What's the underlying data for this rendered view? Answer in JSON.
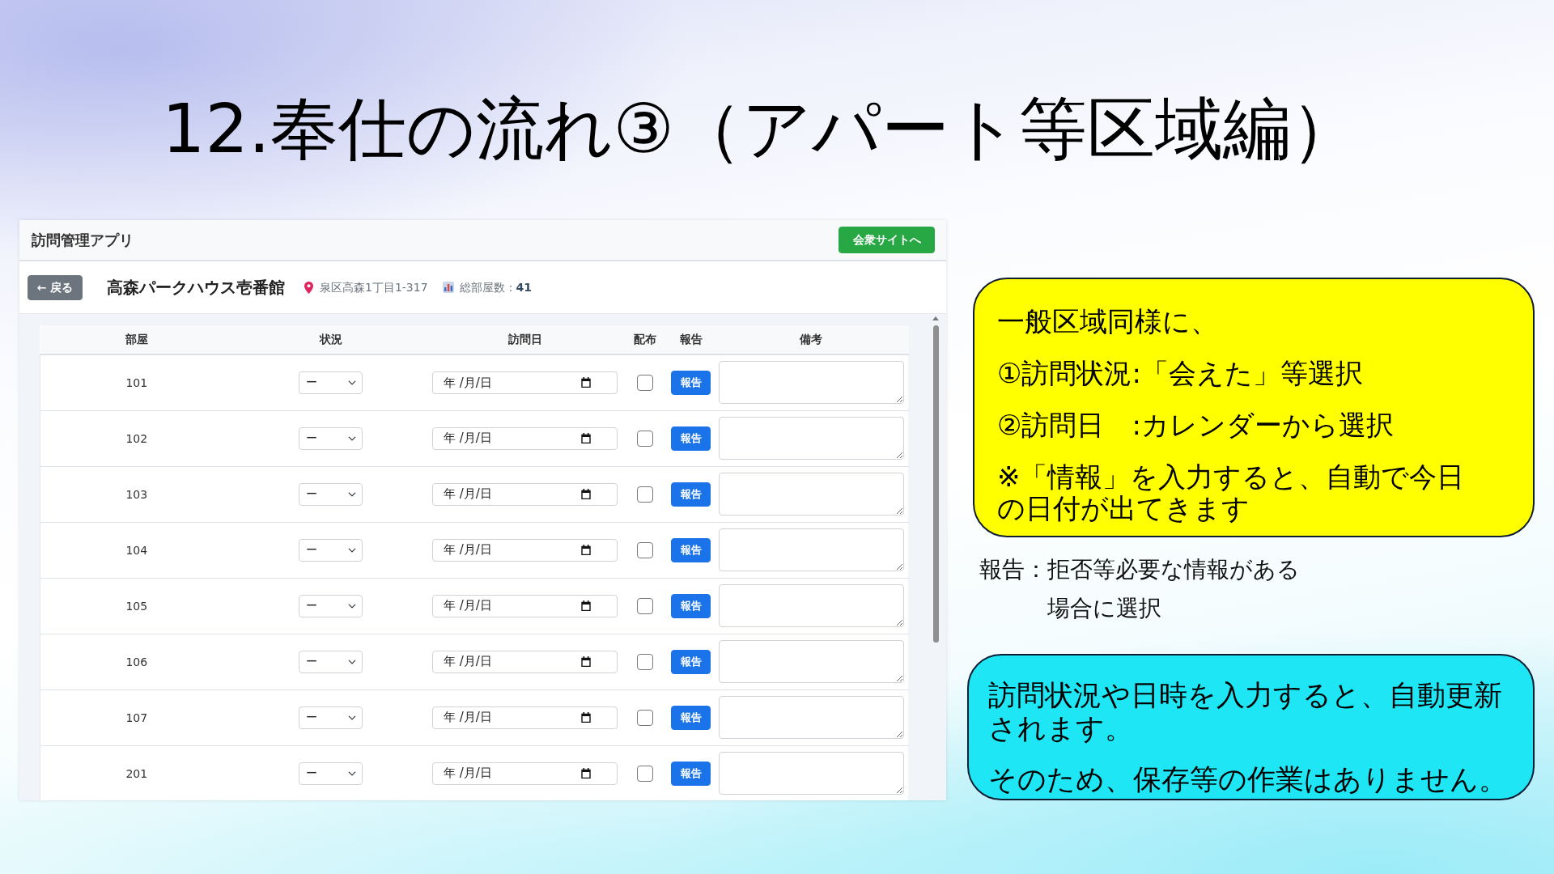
{
  "slide": {
    "title": "12.奉仕の流れ③（アパート等区域編）"
  },
  "app": {
    "header": {
      "title": "訪問管理アプリ",
      "site_button": "会衆サイトへ"
    },
    "building": {
      "back_button": "← 戻る",
      "name": "高森パークハウス壱番館",
      "address": "泉区高森1丁目1-317",
      "room_count": "総部屋数：**41**"
    },
    "table": {
      "columns": [
        "部屋",
        "状況",
        "訪問日",
        "配布",
        "報告",
        "備考"
      ],
      "rows": [
        {
          "room": "101",
          "status": "ー",
          "visit_date": {
            "placeholder": "年 /月/日"
          },
          "distributed": false,
          "report_button": "報告"
        },
        {
          "room": "102",
          "status": "ー",
          "visit_date": {
            "placeholder": "年 /月/日"
          },
          "distributed": false,
          "report_button": "報告"
        },
        {
          "room": "103",
          "status": "ー",
          "visit_date": {
            "placeholder": "年 /月/日"
          },
          "distributed": false,
          "report_button": "報告"
        },
        {
          "room": "104",
          "status": "ー",
          "visit_date": {
            "placeholder": "年 /月/日"
          },
          "distributed": false,
          "report_button": "報告"
        },
        {
          "room": "105",
          "status": "ー",
          "visit_date": {
            "placeholder": "年 /月/日"
          },
          "distributed": false,
          "report_button": "報告"
        },
        {
          "room": "106",
          "status": "ー",
          "visit_date": {
            "placeholder": "年 /月/日"
          },
          "distributed": false,
          "report_button": "報告"
        },
        {
          "room": "107",
          "status": "ー",
          "visit_date": {
            "placeholder": "年 /月/日"
          },
          "distributed": false,
          "report_button": "報告"
        },
        {
          "room": "201",
          "status": "ー",
          "visit_date": {
            "placeholder": "年 /月/日"
          },
          "distributed": false,
          "report_button": "報告"
        }
      ]
    }
  },
  "callouts": [
    {
      "kind": "box",
      "color": "#ffff00",
      "paragraphs": [
        "一般区域同様に、",
        "①訪問状況:「会えた」等選択",
        "②訪問日　:カレンダーから選択",
        "※「情報」を入力すると、自動で今日の日付が出てきます"
      ]
    },
    {
      "kind": "note",
      "label": "報告：",
      "text": "拒否等必要な情報がある場合に選択"
    },
    {
      "kind": "box",
      "color": "#1ee6f5",
      "paragraphs": [
        "訪問状況や日時を入力すると、自動更新されます。",
        "そのため、保存等の作業はありません。"
      ]
    }
  ]
}
